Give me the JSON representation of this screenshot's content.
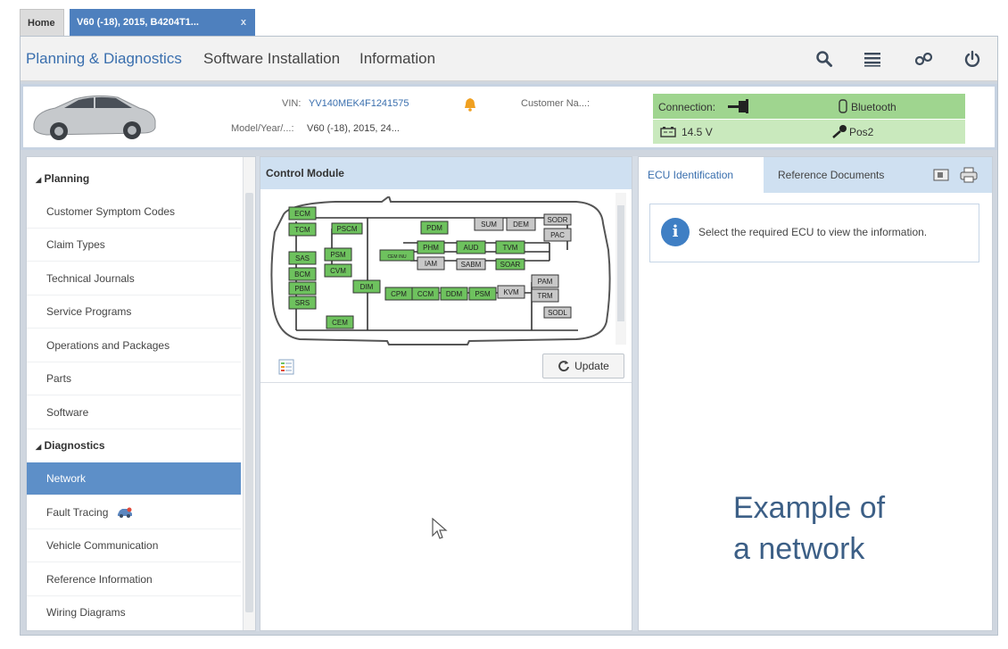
{
  "tabs": {
    "home": "Home",
    "vehicle": "V60 (-18), 2015, B4204T1...",
    "vehicle_close": "x"
  },
  "menu": {
    "items": [
      "Planning & Diagnostics",
      "Software Installation",
      "Information"
    ],
    "tools": [
      "search-icon",
      "list-icon",
      "connection-icon",
      "power-icon"
    ]
  },
  "vehicle": {
    "vin_label": "VIN:",
    "vin": "YV140MEK4F1241575",
    "model_label": "Model/Year/...:",
    "model": "V60 (-18), 2015, 24...",
    "customer_label": "Customer Na...:",
    "connection_label": "Connection:",
    "bluetooth": "Bluetooth",
    "voltage": "14.5 V",
    "ignition": "Pos2"
  },
  "sidebar": {
    "planning_heading": "Planning",
    "planning_items": [
      "Customer Symptom Codes",
      "Claim Types",
      "Technical Journals",
      "Service Programs",
      "Operations and Packages",
      "Parts",
      "Software"
    ],
    "diagnostics_heading": "Diagnostics",
    "diagnostics_items": [
      "Network",
      "Fault Tracing",
      "Vehicle Communication",
      "Reference Information",
      "Wiring Diagrams"
    ],
    "active": "Network"
  },
  "control_module": {
    "title": "Control Module",
    "update_label": "Update",
    "modules": [
      "ECM",
      "TCM",
      "PSCM",
      "PDM",
      "SUM",
      "DEM",
      "SODR",
      "PAC",
      "SAS",
      "PSM",
      "CEM INU",
      "PHM",
      "AUD",
      "TVM",
      "BCM",
      "CVM",
      "IAM",
      "SABM",
      "SOAR",
      "PBM",
      "DIM",
      "CPM",
      "CCM",
      "DDM",
      "PSM",
      "KVM",
      "PAM",
      "TRM",
      "SRS",
      "CEM",
      "SODL"
    ]
  },
  "ecu_panel": {
    "tabs": [
      "ECU Identification",
      "Reference Documents"
    ],
    "message": "Select the required ECU to view the information.",
    "caption_line1": "Example of",
    "caption_line2": "a network"
  },
  "colors": {
    "accent": "#4e80be",
    "active_item": "#5d8fc8",
    "panel_header": "#cfe0f1",
    "module_active": "#6ec25e",
    "module_inactive": "#c8c8c8",
    "connection_green": "#9fd58f"
  }
}
